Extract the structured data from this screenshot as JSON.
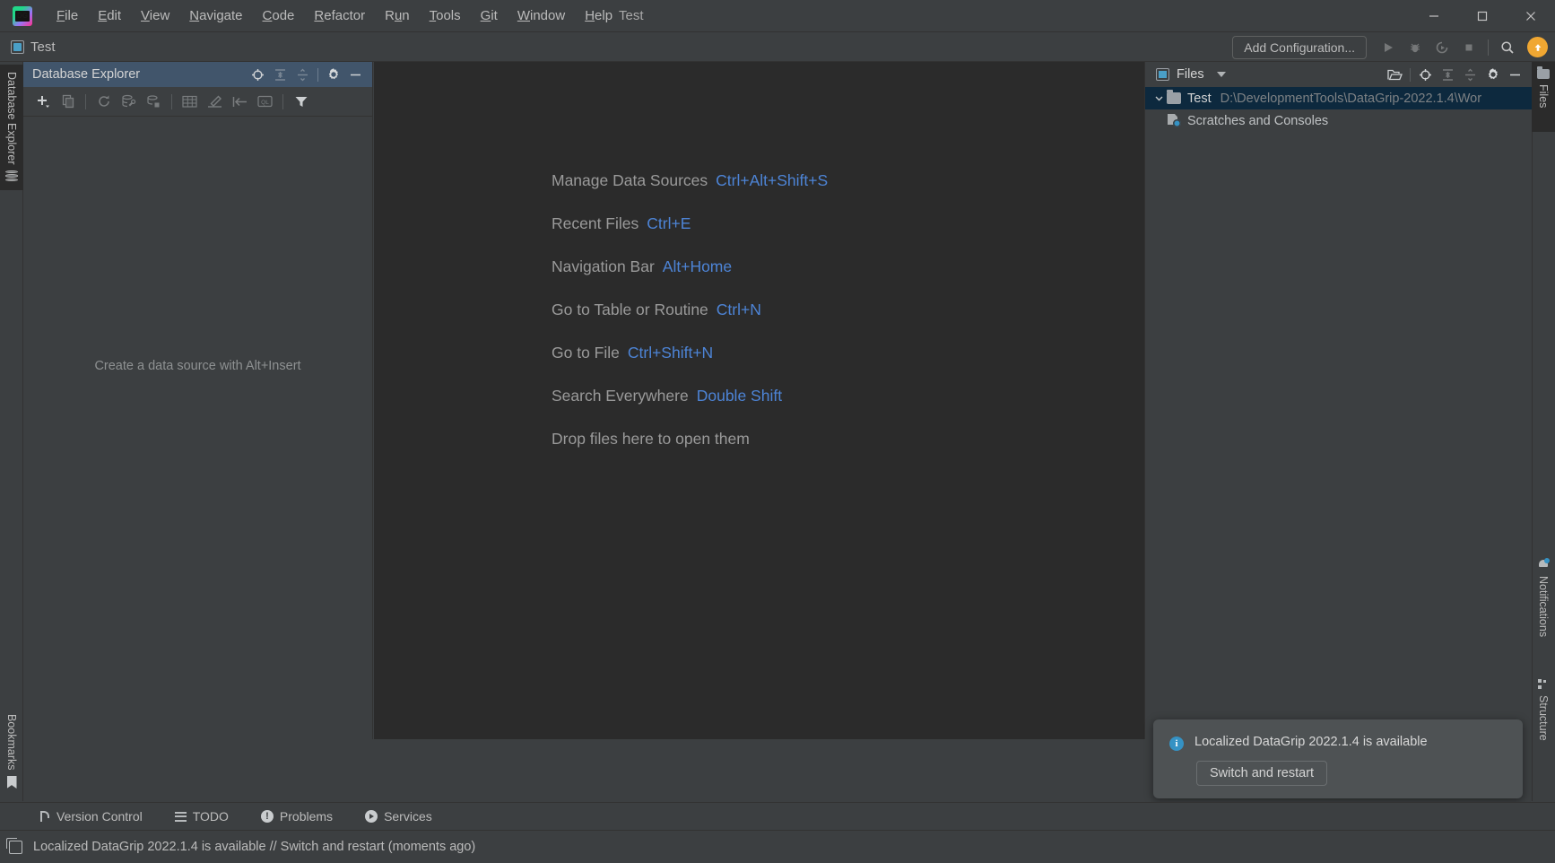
{
  "window": {
    "title": "Test",
    "logo_icon": "datagrip-logo-icon",
    "minimize_icon": "minimize-icon",
    "maximize_icon": "maximize-icon",
    "close_icon": "close-icon"
  },
  "menubar": {
    "items": [
      {
        "label": "File",
        "mnemonic": "F"
      },
      {
        "label": "Edit",
        "mnemonic": "E"
      },
      {
        "label": "View",
        "mnemonic": "V"
      },
      {
        "label": "Navigate",
        "mnemonic": "N"
      },
      {
        "label": "Code",
        "mnemonic": "C"
      },
      {
        "label": "Refactor",
        "mnemonic": "R"
      },
      {
        "label": "Run",
        "mnemonic": "u"
      },
      {
        "label": "Tools",
        "mnemonic": "T"
      },
      {
        "label": "Git",
        "mnemonic": "G"
      },
      {
        "label": "Window",
        "mnemonic": "W"
      },
      {
        "label": "Help",
        "mnemonic": "H"
      }
    ]
  },
  "navbar": {
    "breadcrumb": "Test",
    "breadcrumb_icon": "module-icon",
    "add_configuration": "Add Configuration...",
    "buttons": [
      {
        "name": "run-button",
        "icon": "run-icon",
        "enabled": false
      },
      {
        "name": "debug-button",
        "icon": "debug-icon",
        "enabled": false
      },
      {
        "name": "run-coverage-button",
        "icon": "coverage-icon",
        "enabled": false
      },
      {
        "name": "stop-button",
        "icon": "stop-icon",
        "enabled": false
      },
      {
        "name": "search-everywhere-button",
        "icon": "search-icon",
        "enabled": true
      }
    ],
    "update_button_icon": "update-arrow-icon"
  },
  "left_strip": {
    "tabs": [
      {
        "label": "Database Explorer",
        "icon": "database-icon",
        "active": true
      },
      {
        "label": "Bookmarks",
        "icon": "bookmark-icon",
        "active": false
      }
    ]
  },
  "right_strip": {
    "tabs": [
      {
        "label": "Files",
        "icon": "folder-icon",
        "active": true
      },
      {
        "label": "Notifications",
        "icon": "bell-icon",
        "active": false
      },
      {
        "label": "Structure",
        "icon": "structure-icon",
        "active": false
      }
    ]
  },
  "database_explorer": {
    "title": "Database Explorer",
    "empty_message": "Create a data source with Alt+Insert",
    "header_buttons": [
      {
        "name": "locate-button",
        "icon": "crosshair-icon",
        "enabled": true
      },
      {
        "name": "expand-all-button",
        "icon": "expand-all-icon",
        "enabled": false
      },
      {
        "name": "collapse-all-button",
        "icon": "collapse-all-icon",
        "enabled": false
      },
      {
        "name": "settings-button",
        "icon": "gear-icon",
        "enabled": true
      },
      {
        "name": "hide-button",
        "icon": "minus-icon",
        "enabled": true
      }
    ],
    "toolbar_buttons": [
      {
        "name": "new-button",
        "icon": "plus-icon",
        "enabled": true
      },
      {
        "name": "duplicate-button",
        "icon": "copy-icon",
        "enabled": false
      },
      {
        "name": "refresh-button",
        "icon": "refresh-icon",
        "enabled": false
      },
      {
        "name": "data-source-properties-button",
        "icon": "db-settings-icon",
        "enabled": false
      },
      {
        "name": "sync-button",
        "icon": "db-sync-icon",
        "enabled": false
      },
      {
        "name": "open-table-editor-button",
        "icon": "table-icon",
        "enabled": false
      },
      {
        "name": "modify-button",
        "icon": "pencil-icon",
        "enabled": false
      },
      {
        "name": "jump-to-button",
        "icon": "jump-icon",
        "enabled": false
      },
      {
        "name": "ql-console-button",
        "icon": "ql-console-icon",
        "enabled": false
      },
      {
        "name": "filter-button",
        "icon": "filter-icon",
        "enabled": true
      }
    ]
  },
  "editor": {
    "shortcuts": [
      {
        "label": "Manage Data Sources",
        "key": "Ctrl+Alt+Shift+S"
      },
      {
        "label": "Recent Files",
        "key": "Ctrl+E"
      },
      {
        "label": "Navigation Bar",
        "key": "Alt+Home"
      },
      {
        "label": "Go to Table or Routine",
        "key": "Ctrl+N"
      },
      {
        "label": "Go to File",
        "key": "Ctrl+Shift+N"
      },
      {
        "label": "Search Everywhere",
        "key": "Double Shift"
      },
      {
        "label": "Drop files here to open them",
        "key": ""
      }
    ]
  },
  "files_panel": {
    "title": "Files",
    "title_icon": "module-icon",
    "dropdown_icon": "chevron-down-icon",
    "header_buttons": [
      {
        "name": "open-files-button",
        "icon": "open-folder-icon",
        "enabled": true
      },
      {
        "name": "locate-button",
        "icon": "crosshair-icon",
        "enabled": true
      },
      {
        "name": "expand-all-button",
        "icon": "expand-all-icon",
        "enabled": false
      },
      {
        "name": "collapse-all-button",
        "icon": "collapse-all-icon",
        "enabled": false
      },
      {
        "name": "settings-button",
        "icon": "gear-icon",
        "enabled": true
      },
      {
        "name": "hide-button",
        "icon": "minus-icon",
        "enabled": true
      }
    ],
    "tree": [
      {
        "name": "Test",
        "path": "D:\\DevelopmentTools\\DataGrip-2022.1.4\\Wor",
        "icon": "folder-icon",
        "expanded": true,
        "selected": true
      },
      {
        "name": "Scratches and Consoles",
        "path": "",
        "icon": "scratches-icon",
        "expanded": false,
        "selected": false
      }
    ]
  },
  "notification_balloon": {
    "icon": "info-icon",
    "message": "Localized DataGrip 2022.1.4 is available",
    "action_label": "Switch and restart"
  },
  "bottom_bar": {
    "items": [
      {
        "label": "Version Control",
        "icon": "vcs-icon"
      },
      {
        "label": "TODO",
        "icon": "todo-icon"
      },
      {
        "label": "Problems",
        "icon": "problems-icon"
      },
      {
        "label": "Services",
        "icon": "services-icon"
      }
    ]
  },
  "status_bar": {
    "icon": "notification-log-icon",
    "text": "Localized DataGrip 2022.1.4 is available // Switch and restart (moments ago)"
  },
  "colors": {
    "accent_blue": "#4d84d6",
    "panel_bg": "#3c3f41",
    "editor_bg": "#2b2b2b",
    "selection_bg": "#0d293e",
    "header_active": "#41556b",
    "update_orange": "#f0a732",
    "info_blue": "#3592c4"
  }
}
